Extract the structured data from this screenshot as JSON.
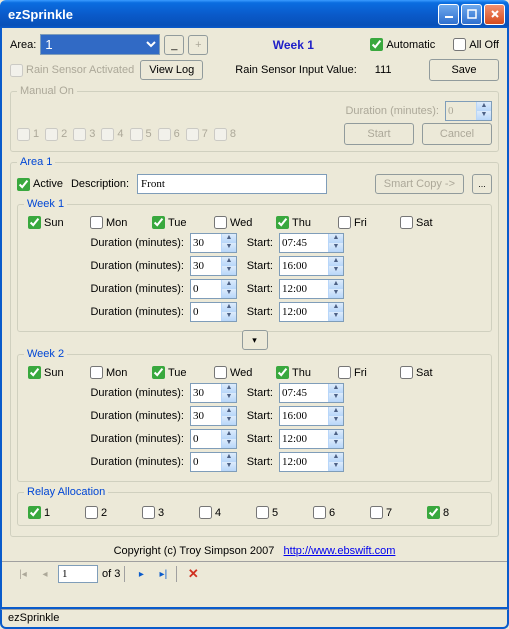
{
  "window": {
    "title": "ezSprinkle"
  },
  "header": {
    "area_label": "Area:",
    "area_value": "1",
    "minus": "_",
    "plus": "+",
    "week_indicator": "Week 1",
    "automatic_label": "Automatic",
    "automatic_checked": true,
    "alloff_label": "All Off",
    "alloff_checked": false
  },
  "sensor": {
    "rain_sensor_activated_label": "Rain Sensor Activated",
    "rain_sensor_activated_checked": false,
    "view_log_label": "View Log",
    "rain_value_label": "Rain Sensor Input Value:",
    "rain_value": "111",
    "save_label": "Save"
  },
  "manual": {
    "legend": "Manual On",
    "stations": [
      "1",
      "2",
      "3",
      "4",
      "5",
      "6",
      "7",
      "8"
    ],
    "duration_label": "Duration (minutes):",
    "duration_value": "0",
    "start_label": "Start",
    "cancel_label": "Cancel"
  },
  "area1": {
    "legend": "Area 1",
    "active_label": "Active",
    "active_checked": true,
    "description_label": "Description:",
    "description_value": "Front",
    "smart_copy_label": "Smart Copy ->",
    "dots": "..."
  },
  "week1": {
    "legend": "Week 1",
    "days": [
      {
        "label": "Sun",
        "checked": true
      },
      {
        "label": "Mon",
        "checked": false
      },
      {
        "label": "Tue",
        "checked": true
      },
      {
        "label": "Wed",
        "checked": false
      },
      {
        "label": "Thu",
        "checked": true
      },
      {
        "label": "Fri",
        "checked": false
      },
      {
        "label": "Sat",
        "checked": false
      }
    ],
    "duration_label": "Duration (minutes):",
    "start_label": "Start:",
    "rows": [
      {
        "duration": "30",
        "start": "07:45"
      },
      {
        "duration": "30",
        "start": "16:00"
      },
      {
        "duration": "0",
        "start": "12:00"
      },
      {
        "duration": "0",
        "start": "12:00"
      }
    ]
  },
  "week2": {
    "legend": "Week 2",
    "days": [
      {
        "label": "Sun",
        "checked": true
      },
      {
        "label": "Mon",
        "checked": false
      },
      {
        "label": "Tue",
        "checked": true
      },
      {
        "label": "Wed",
        "checked": false
      },
      {
        "label": "Thu",
        "checked": true
      },
      {
        "label": "Fri",
        "checked": false
      },
      {
        "label": "Sat",
        "checked": false
      }
    ],
    "duration_label": "Duration (minutes):",
    "start_label": "Start:",
    "rows": [
      {
        "duration": "30",
        "start": "07:45"
      },
      {
        "duration": "30",
        "start": "16:00"
      },
      {
        "duration": "0",
        "start": "12:00"
      },
      {
        "duration": "0",
        "start": "12:00"
      }
    ]
  },
  "relay": {
    "legend": "Relay Allocation",
    "items": [
      {
        "label": "1",
        "checked": true
      },
      {
        "label": "2",
        "checked": false
      },
      {
        "label": "3",
        "checked": false
      },
      {
        "label": "4",
        "checked": false
      },
      {
        "label": "5",
        "checked": false
      },
      {
        "label": "6",
        "checked": false
      },
      {
        "label": "7",
        "checked": false
      },
      {
        "label": "8",
        "checked": true
      }
    ]
  },
  "copyright": {
    "text": "Copyright (c) Troy Simpson 2007",
    "link_text": "http://www.ebswift.com"
  },
  "nav": {
    "page": "1",
    "of_text": "of 3"
  },
  "status": {
    "text": "ezSprinkle"
  }
}
